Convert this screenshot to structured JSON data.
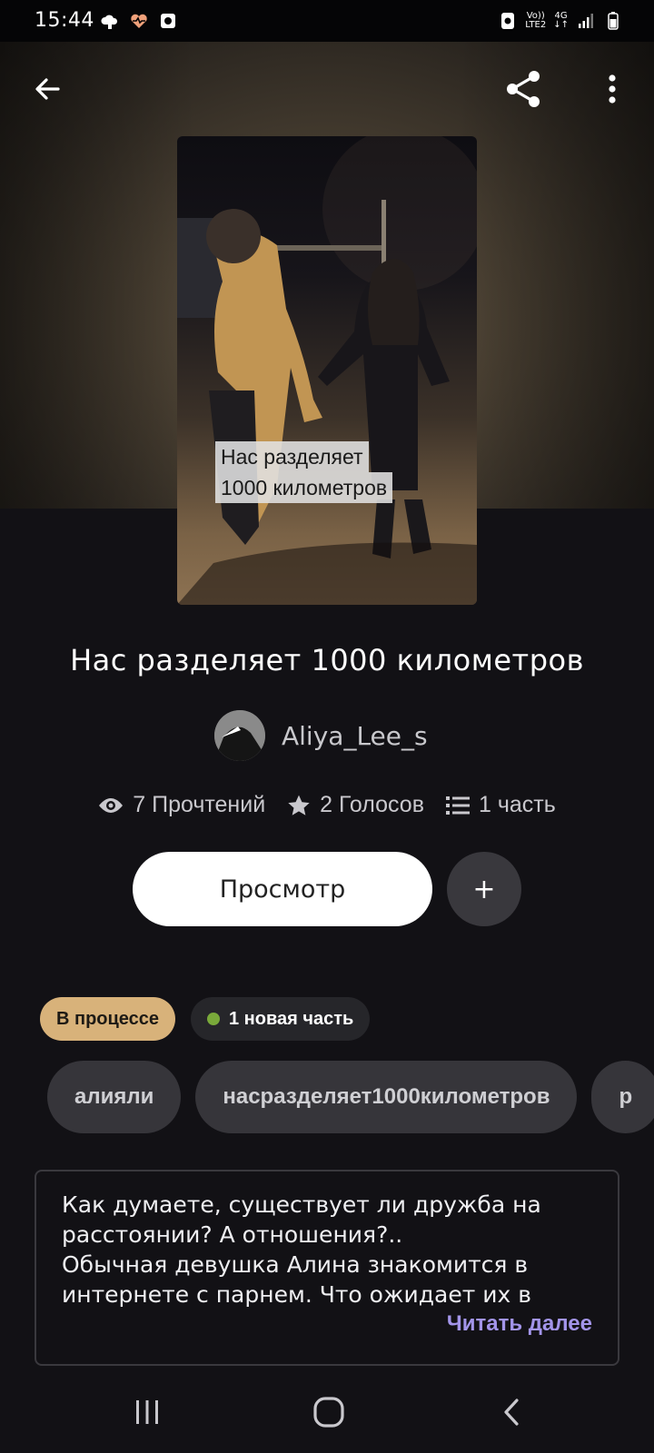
{
  "status_bar": {
    "time": "15:44",
    "network_top": "Vo))",
    "network_bottom": "LTE2",
    "network_type": "4G"
  },
  "header": {
    "back_icon": "arrow-left-icon",
    "share_icon": "share-icon",
    "more_icon": "more-vertical-icon"
  },
  "cover": {
    "caption_line1": "Нас разделяет",
    "caption_line2": "1000 километров"
  },
  "story": {
    "title": "Нас разделяет 1000 километров",
    "author": "Aliya_Lee_s",
    "reads": "7 Прочтений",
    "votes": "2 Голосов",
    "parts": "1 часть"
  },
  "actions": {
    "read_label": "Просмотр",
    "add_label": "+"
  },
  "badges": {
    "status": "В процессе",
    "new_part": "1 новая часть"
  },
  "tags": [
    "алияли",
    "насразделяет1000километров",
    "р"
  ],
  "description": {
    "text": "Как думаете, существует ли дружба на расстоянии? А отношения?..\nОбычная девушка Алина знакомится в интернете с парнем. Что ожидает их в",
    "read_more": "Читать далее"
  },
  "colors": {
    "background": "#121115",
    "status_badge": "#d8b27a",
    "new_dot": "#79a93a",
    "read_more": "#a395ea",
    "tag_bg": "#36353a"
  }
}
